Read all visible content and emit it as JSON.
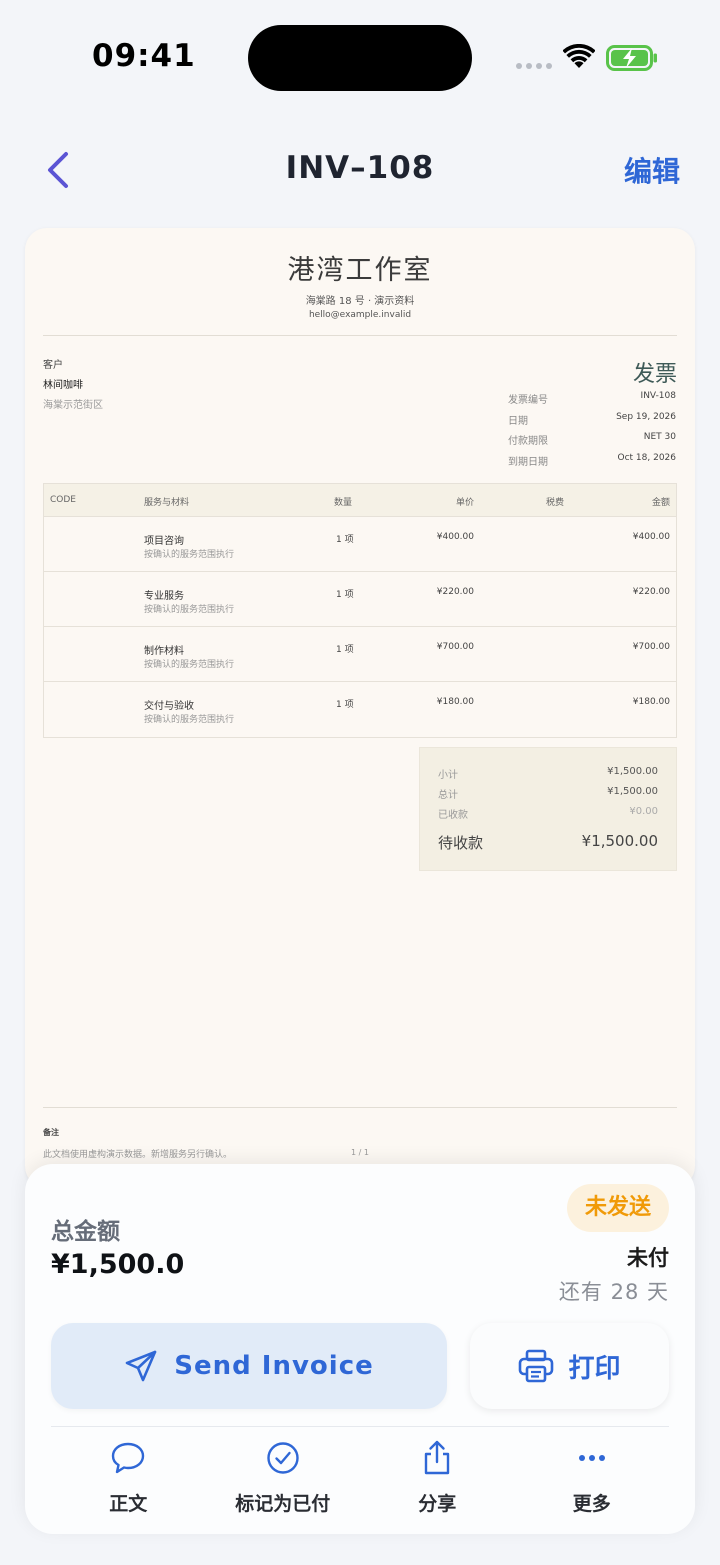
{
  "status_bar": {
    "time": "09:41"
  },
  "nav": {
    "title": "INV–108",
    "edit_label": "编辑"
  },
  "invoice": {
    "studio_name": "港湾工作室",
    "studio_address": "海棠路 18 号 · 演示资料",
    "studio_email": "hello@example.invalid",
    "client_label": "客户",
    "client_name": "林间咖啡",
    "client_address": "海棠示范街区",
    "doc_type": "发票",
    "meta": [
      {
        "key": "发票编号",
        "value": "INV-108"
      },
      {
        "key": "日期",
        "value": "Sep 19, 2026"
      },
      {
        "key": "付款期限",
        "value": "NET 30"
      },
      {
        "key": "到期日期",
        "value": "Oct 18, 2026"
      }
    ],
    "columns": {
      "code": "CODE",
      "item": "服务与材料",
      "qty": "数量",
      "price": "单价",
      "tax": "税费",
      "amount": "金额"
    },
    "items": [
      {
        "name": "项目咨询",
        "desc": "按确认的服务范围执行",
        "qty": "1 项",
        "price": "¥400.00",
        "amount": "¥400.00"
      },
      {
        "name": "专业服务",
        "desc": "按确认的服务范围执行",
        "qty": "1 项",
        "price": "¥220.00",
        "amount": "¥220.00"
      },
      {
        "name": "制作材料",
        "desc": "按确认的服务范围执行",
        "qty": "1 项",
        "price": "¥700.00",
        "amount": "¥700.00"
      },
      {
        "name": "交付与验收",
        "desc": "按确认的服务范围执行",
        "qty": "1 项",
        "price": "¥180.00",
        "amount": "¥180.00"
      }
    ],
    "totals": {
      "subtotal_label": "小计",
      "subtotal": "¥1,500.00",
      "total_label": "总计",
      "total": "¥1,500.00",
      "paid_label": "已收款",
      "paid": "¥0.00",
      "due_label": "待收款",
      "due": "¥1,500.00"
    },
    "notes_label": "备注",
    "notes_text": "此文档使用虚构演示数据。新增服务另行确认。",
    "page": "1 / 1"
  },
  "sheet": {
    "total_label": "总金额",
    "total_value": "¥1,500.0",
    "status_badge": "未发送",
    "paid_status": "未付",
    "due_days": "还有 28 天",
    "send_label": "Send Invoice",
    "print_label": "打印",
    "tabs": [
      {
        "label": "正文",
        "icon": "chat-bubble-icon"
      },
      {
        "label": "标记为已付",
        "icon": "check-circle-icon"
      },
      {
        "label": "分享",
        "icon": "share-icon"
      },
      {
        "label": "更多",
        "icon": "more-icon"
      }
    ]
  },
  "colors": {
    "accent": "#2f67d6",
    "badge": "#f09a08",
    "back_chevron": "#5b54d4"
  }
}
